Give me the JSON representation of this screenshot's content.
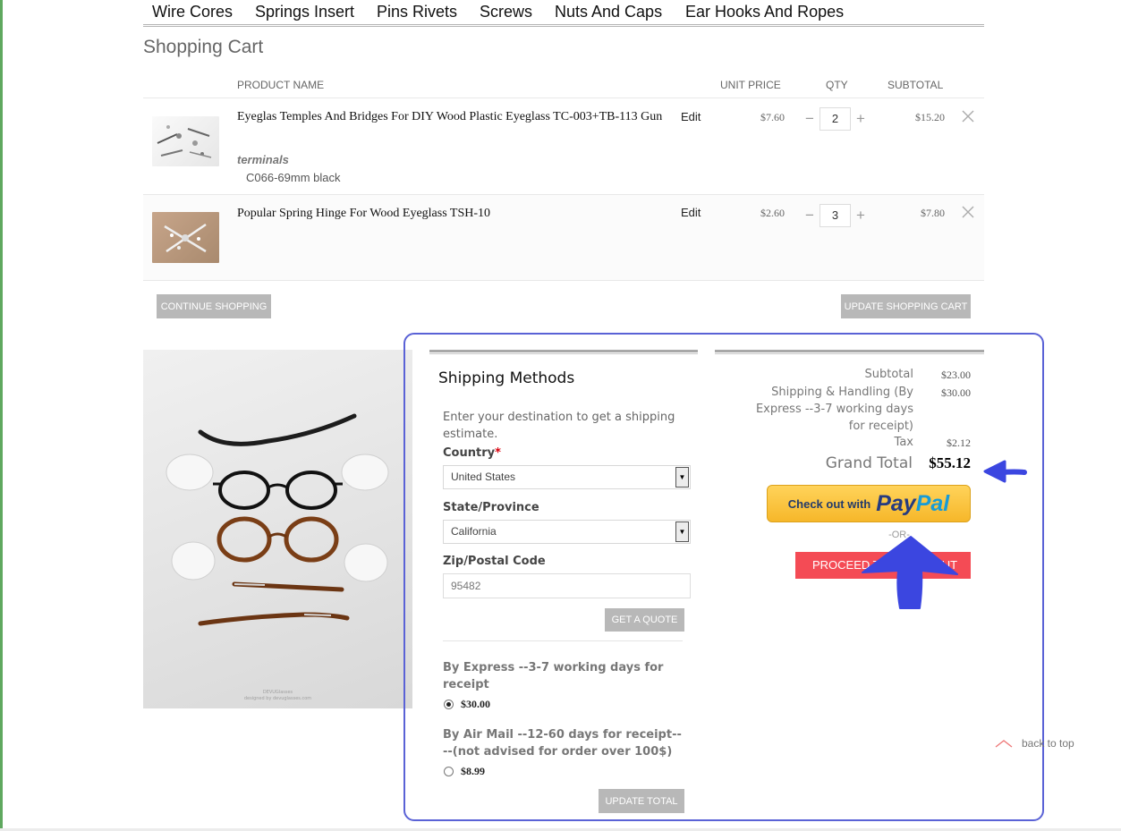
{
  "nav": {
    "items": [
      "Wire Cores",
      "Springs Insert",
      "Pins Rivets",
      "Screws",
      "Nuts And Caps",
      "Ear Hooks And Ropes"
    ]
  },
  "page": {
    "title": "Shopping Cart"
  },
  "cart": {
    "headers": {
      "product": "PRODUCT NAME",
      "unit_price": "UNIT PRICE",
      "qty": "QTY",
      "subtotal": "SUBTOTAL"
    },
    "items": [
      {
        "name": "Eyeglas Temples And Bridges For DIY Wood Plastic Eyeglass TC-003+TB-113 Gun",
        "option_label": "terminals",
        "option_value": "C066-69mm black",
        "edit_label": "Edit",
        "unit_price": "$7.60",
        "qty": "2",
        "subtotal": "$15.20"
      },
      {
        "name": "Popular Spring Hinge For Wood Eyeglass TSH-10",
        "edit_label": "Edit",
        "unit_price": "$2.60",
        "qty": "3",
        "subtotal": "$7.80"
      }
    ],
    "qty_minus": "−",
    "qty_plus": "+",
    "continue_label": "CONTINUE SHOPPING",
    "update_label": "UPDATE SHOPPING CART"
  },
  "photo": {
    "caption_line1": "DEVUGlasses",
    "caption_line2": "designed by devuglasses.com"
  },
  "shipping": {
    "title": "Shipping Methods",
    "intro": "Enter your destination to get a shipping estimate.",
    "country_label": "Country",
    "required_mark": "*",
    "country_value": "United States",
    "state_label": "State/Province",
    "state_value": "California",
    "zip_label": "Zip/Postal Code",
    "zip_value": "95482",
    "quote_label": "GET A QUOTE",
    "methods": [
      {
        "label": "By Express --3-7 working days for receipt",
        "price": "$30.00",
        "selected": true
      },
      {
        "label": "By Air Mail --12-60 days for receipt----(not advised for order over 100$)",
        "price": "$8.99",
        "selected": false
      }
    ],
    "update_total_label": "UPDATE TOTAL"
  },
  "totals": {
    "subtotal_label": "Subtotal",
    "subtotal_value": "$23.00",
    "shipping_label": "Shipping & Handling (By Express --3-7 working days for receipt)",
    "shipping_value": "$30.00",
    "tax_label": "Tax",
    "tax_value": "$2.12",
    "grand_label": "Grand Total",
    "grand_value": "$55.12",
    "paypal_text": "Check out with",
    "paypal_pay": "Pay",
    "paypal_pal": "Pal",
    "or_label": "-OR-",
    "checkout_label": "PROCEED TO CHECKOUT"
  },
  "footer": {
    "back_to_top": "back to top"
  },
  "colors": {
    "accent_red": "#f44b55",
    "annotation_blue": "#5a62d6",
    "paypal_yellow": "#ffc439",
    "button_gray": "#b8b8b8"
  }
}
